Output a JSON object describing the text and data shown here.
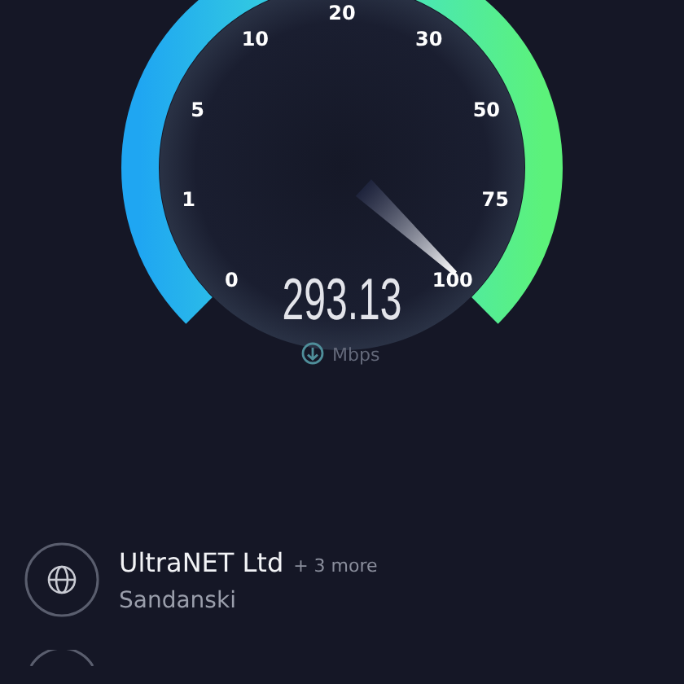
{
  "gauge": {
    "ticks": [
      "0",
      "1",
      "5",
      "10",
      "20",
      "30",
      "50",
      "75",
      "100"
    ],
    "reading": "293.13",
    "unit": "Mbps"
  },
  "providers": [
    {
      "name": "UltraNET Ltd",
      "extra": "+ 3 more",
      "location": "Sandanski"
    }
  ]
}
